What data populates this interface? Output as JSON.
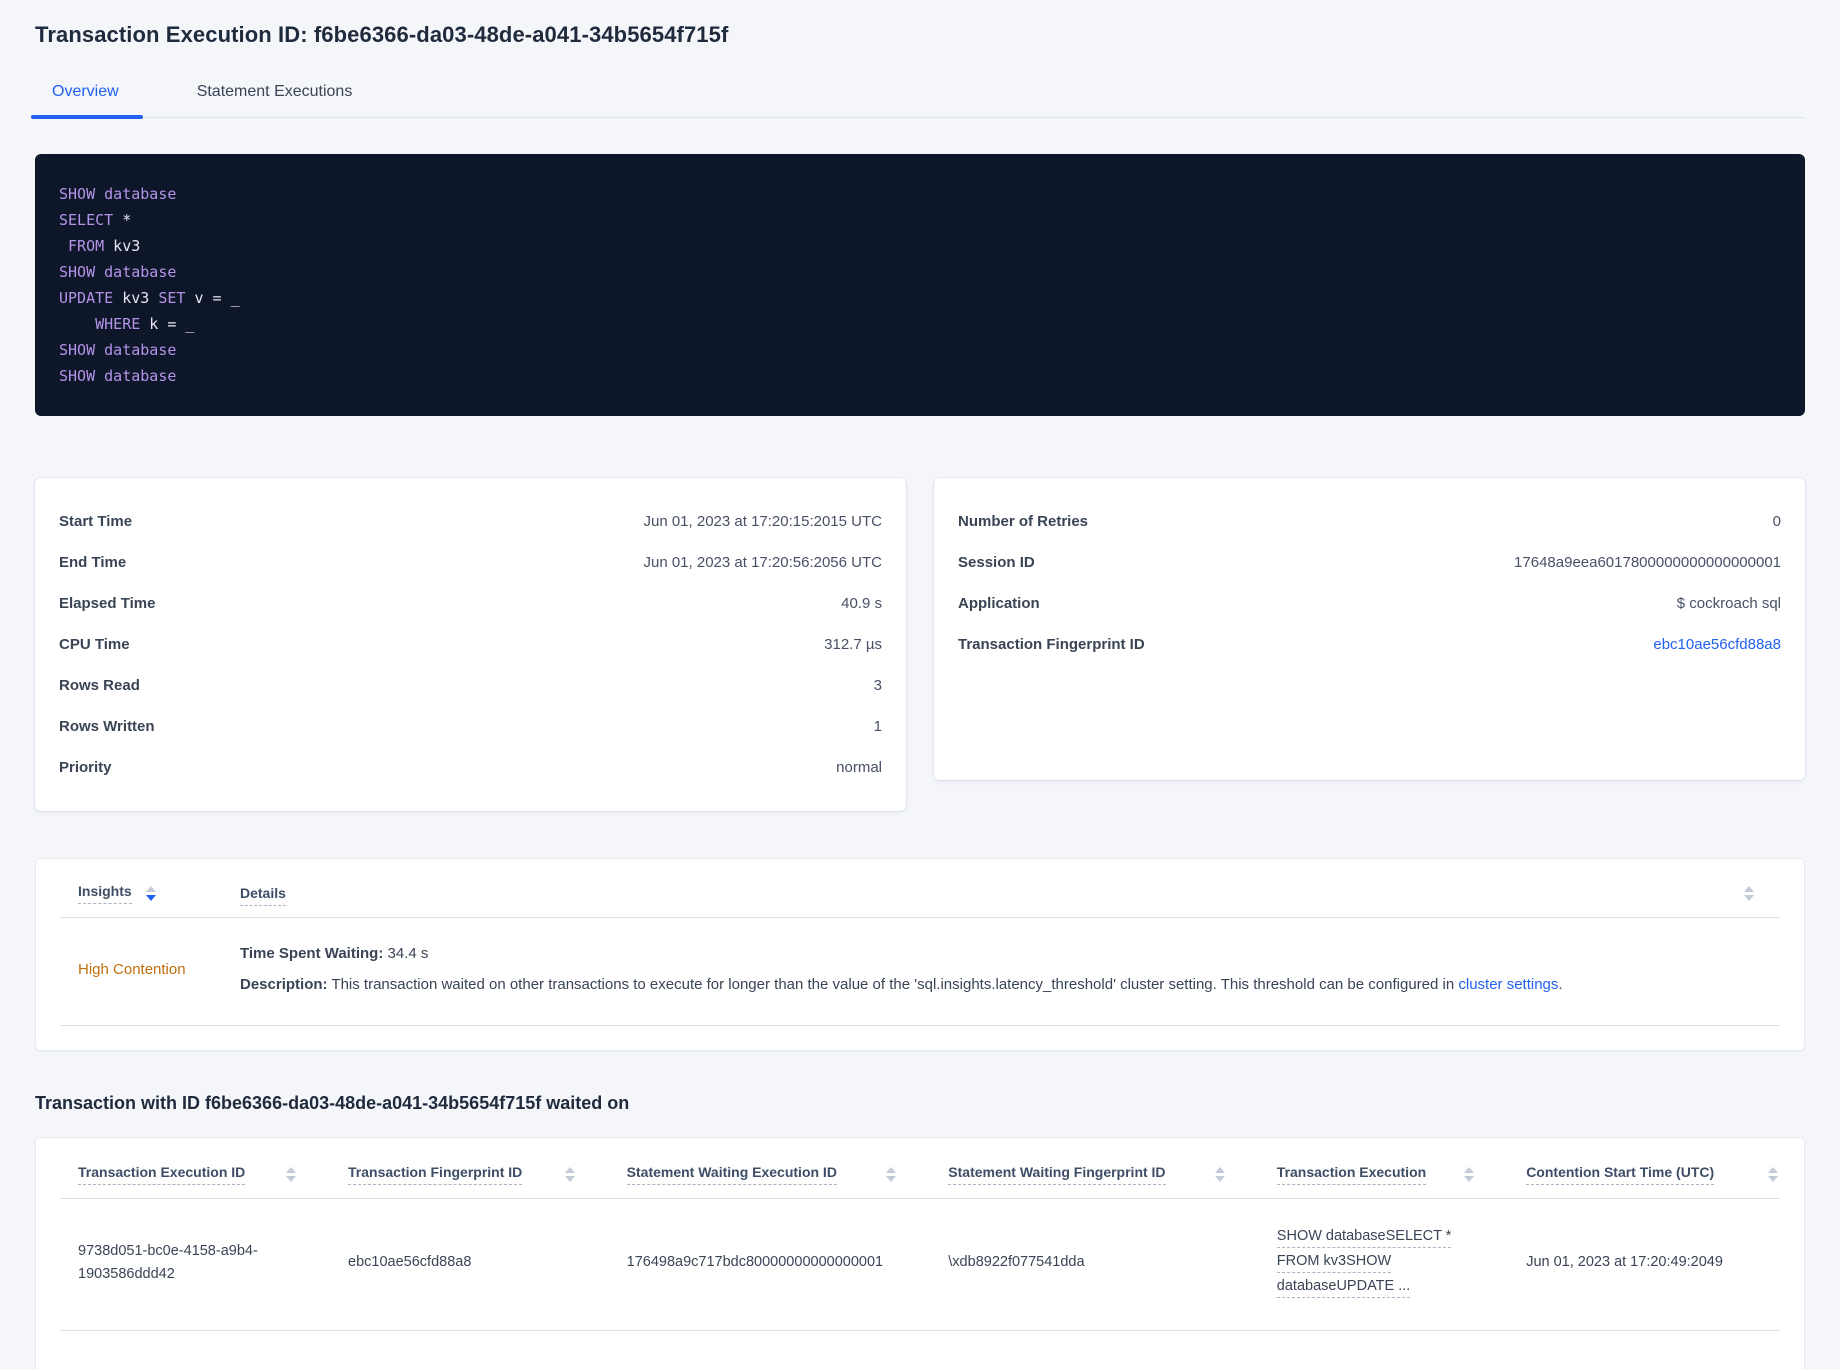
{
  "page": {
    "title": "Transaction Execution ID: f6be6366-da03-48de-a041-34b5654f715f"
  },
  "colors": {
    "accent_blue": "#2161f2",
    "warning_orange": "#c16e0c",
    "code_background": "#0e1729",
    "code_keyword": "#b593e8"
  },
  "tabs": {
    "items": [
      {
        "label": "Overview",
        "active": true
      },
      {
        "label": "Statement Executions",
        "active": false
      }
    ]
  },
  "sql": {
    "lines": [
      {
        "kw1": "SHOW database"
      },
      {
        "kw1": "SELECT",
        "pl1": " *"
      },
      {
        "pl0": " ",
        "kw1": "FROM",
        "pl1": " kv3"
      },
      {
        "kw1": "SHOW database"
      },
      {
        "kw1": "UPDATE",
        "pl1": " kv3 ",
        "kw2": "SET",
        "pl2": " v = _"
      },
      {
        "pl0": "    ",
        "kw1": "WHERE",
        "pl1": " k = _"
      },
      {
        "kw1": "SHOW database"
      },
      {
        "kw1": "SHOW database"
      }
    ]
  },
  "summary_left": {
    "rows": [
      {
        "label": "Start Time",
        "value": "Jun 01, 2023 at 17:20:15:2015 UTC"
      },
      {
        "label": "End Time",
        "value": "Jun 01, 2023 at 17:20:56:2056 UTC"
      },
      {
        "label": "Elapsed Time",
        "value": "40.9 s"
      },
      {
        "label": "CPU Time",
        "value": "312.7 µs"
      },
      {
        "label": "Rows Read",
        "value": "3"
      },
      {
        "label": "Rows Written",
        "value": "1"
      },
      {
        "label": "Priority",
        "value": "normal"
      }
    ]
  },
  "summary_right": {
    "rows": [
      {
        "label": "Number of Retries",
        "value": "0"
      },
      {
        "label": "Session ID",
        "value": "17648a9eea6017800000000000000001"
      },
      {
        "label": "Application",
        "value": "$ cockroach sql"
      },
      {
        "label": "Transaction Fingerprint ID",
        "value": "ebc10ae56cfd88a8"
      }
    ]
  },
  "insights_table": {
    "sort": {
      "column": "Insights",
      "direction": "desc"
    },
    "col_insights": "Insights",
    "col_details": "Details",
    "row": {
      "insight": "High Contention",
      "waiting_label": "Time Spent Waiting:",
      "waiting_value": " 34.4 s",
      "desc_label": "Description:",
      "desc_text": " This transaction waited on other transactions to execute for longer than the value of the 'sql.insights.latency_threshold' cluster setting. This threshold can be configured in ",
      "desc_link": "cluster settings",
      "desc_end": "."
    }
  },
  "waited_on": {
    "heading": "Transaction with ID f6be6366-da03-48de-a041-34b5654f715f waited on",
    "columns": [
      "Transaction Execution ID",
      "Transaction Fingerprint ID",
      "Statement Waiting Execution ID",
      "Statement Waiting Fingerprint ID",
      "Transaction Execution",
      "Contention Start Time (UTC)"
    ],
    "row": {
      "txn_execution_id": "9738d051-bc0e-4158-a9b4-1903586ddd42",
      "txn_fingerprint_id": "ebc10ae56cfd88a8",
      "stmt_waiting_execution_id": "176498a9c717bdc80000000000000001",
      "stmt_waiting_fingerprint_id": "\\xdb8922f077541dda",
      "txn_execution_lines": [
        "SHOW databaseSELECT *",
        "FROM kv3SHOW",
        "databaseUPDATE ..."
      ],
      "contention_start": "Jun 01, 2023 at 17:20:49:2049"
    }
  }
}
